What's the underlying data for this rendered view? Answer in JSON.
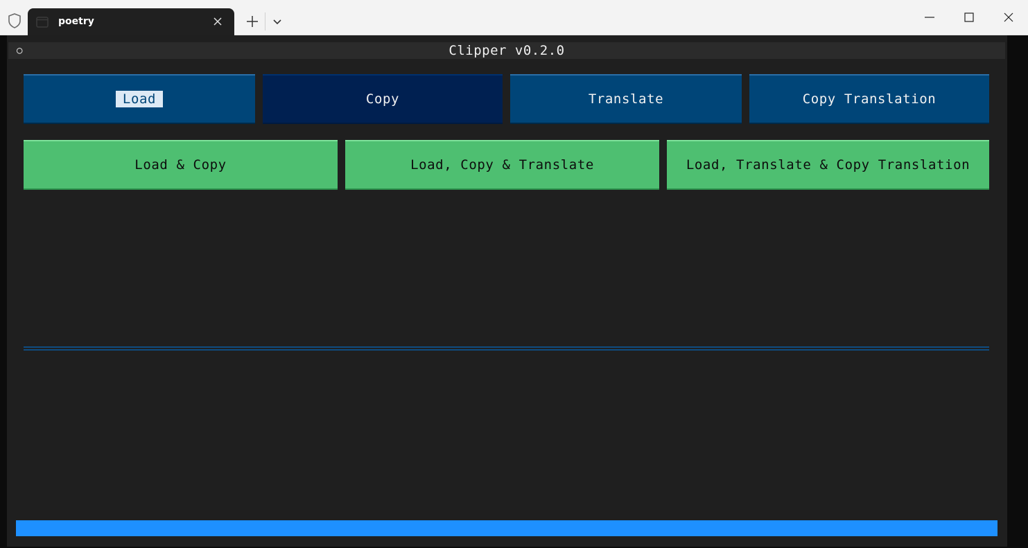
{
  "window": {
    "tab_title": "poetry"
  },
  "app": {
    "header_icon": "○",
    "title": "Clipper v0.2.0"
  },
  "buttons_row1": [
    {
      "label": "Load"
    },
    {
      "label": "Copy"
    },
    {
      "label": "Translate"
    },
    {
      "label": "Copy Translation"
    }
  ],
  "buttons_row2": [
    {
      "label": "Load & Copy"
    },
    {
      "label": "Load, Copy & Translate"
    },
    {
      "label": "Load, Translate & Copy Translation"
    }
  ],
  "progress": {
    "fraction": 1.0
  },
  "colors": {
    "primary_button": "#004578",
    "active_button": "#002051",
    "success_button": "#4ebf71",
    "progress_bar": "#1e90ff",
    "background": "#1f1f1f"
  },
  "icons": {
    "shield": "shield-icon",
    "terminal": "terminal-icon",
    "close": "close-icon",
    "new_tab": "plus-icon",
    "dropdown": "chevron-down-icon",
    "minimize": "minimize-icon",
    "maximize": "maximize-icon",
    "window_close": "close-icon"
  }
}
